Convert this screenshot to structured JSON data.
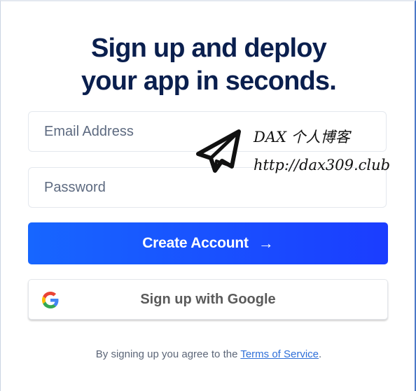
{
  "heading": {
    "line1": "Sign up and deploy",
    "line2": "your app in seconds."
  },
  "form": {
    "email_placeholder": "Email Address",
    "password_placeholder": "Password",
    "create_button_label": "Create Account",
    "create_button_arrow": "→",
    "google_button_label": "Sign up with Google"
  },
  "terms": {
    "prefix": "By signing up you agree to the ",
    "link": "Terms of Service",
    "suffix": "."
  },
  "watermark": {
    "line1": "DAX 个人博客",
    "line2": "http://dax309.club",
    "icon": "paper-plane-icon"
  },
  "colors": {
    "heading": "#0a1f4e",
    "primary_button_start": "#1766ff",
    "primary_button_end": "#1b3dff",
    "link": "#2f6fd8"
  }
}
